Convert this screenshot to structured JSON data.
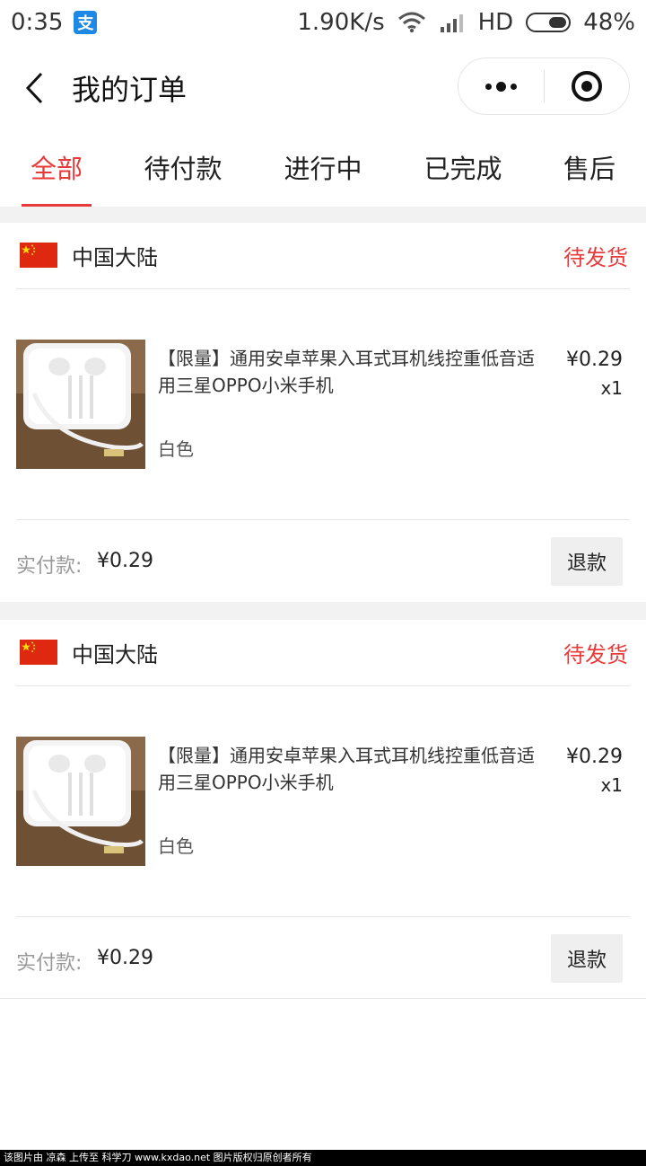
{
  "status_bar": {
    "time": "0:35",
    "alipay_glyph": "支",
    "network_speed": "1.90K/s",
    "hd_label": "HD",
    "battery": "48%"
  },
  "nav": {
    "title": "我的订单"
  },
  "tabs": [
    {
      "label": "全部",
      "active": true
    },
    {
      "label": "待付款",
      "active": false
    },
    {
      "label": "进行中",
      "active": false
    },
    {
      "label": "已完成",
      "active": false
    },
    {
      "label": "售后",
      "active": false
    }
  ],
  "orders": [
    {
      "region": "中国大陆",
      "status": "待发货",
      "product_name": "【限量】通用安卓苹果入耳式耳机线控重低音适用三星OPPO小米手机",
      "spec": "白色",
      "price": "¥0.29",
      "qty": "x1",
      "paid_label": "实付款:",
      "paid_amount": "¥0.29",
      "refund_label": "退款"
    },
    {
      "region": "中国大陆",
      "status": "待发货",
      "product_name": "【限量】通用安卓苹果入耳式耳机线控重低音适用三星OPPO小米手机",
      "spec": "白色",
      "price": "¥0.29",
      "qty": "x1",
      "paid_label": "实付款:",
      "paid_amount": "¥0.29",
      "refund_label": "退款"
    }
  ],
  "watermark": "该图片由 凉森 上传至 科学刀 www.kxdao.net 图片版权归原创者所有",
  "colors": {
    "accent": "#e83a3a",
    "page_gap": "#f2f2f2"
  }
}
